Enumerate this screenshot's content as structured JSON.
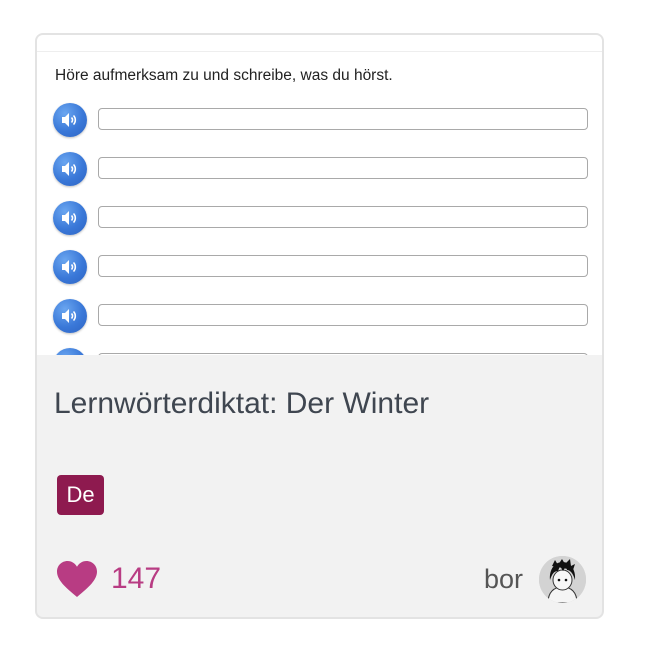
{
  "preview": {
    "instruction": "Höre aufmerksam zu und schreibe, was du hörst.",
    "rows": [
      {
        "icon": "speaker-icon",
        "value": ""
      },
      {
        "icon": "speaker-icon",
        "value": ""
      },
      {
        "icon": "speaker-icon",
        "value": ""
      },
      {
        "icon": "speaker-icon",
        "value": ""
      },
      {
        "icon": "speaker-icon",
        "value": ""
      },
      {
        "icon": "speaker-icon",
        "value": ""
      }
    ]
  },
  "card": {
    "title": "Lernwörterdiktat: Der Winter",
    "language_badge": "De",
    "likes": "147",
    "author": "bor"
  },
  "colors": {
    "accent_blue": "#3a78d8",
    "badge_bg": "#8e1a4f",
    "like_pink": "#b83c83",
    "card_bg": "#f2f2f2"
  }
}
